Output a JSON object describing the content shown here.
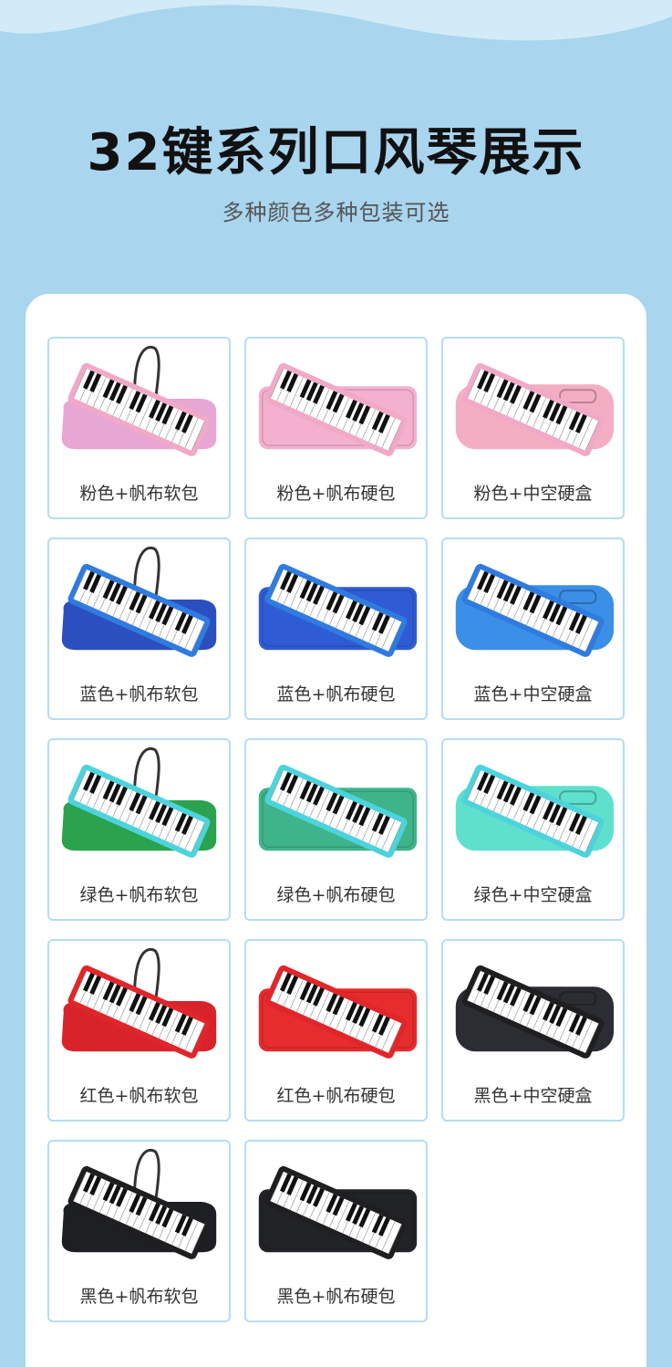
{
  "header": {
    "title": "32键系列口风琴展示",
    "subtitle": "多种颜色多种包装可选"
  },
  "products": [
    {
      "label": "粉色+帆布软包",
      "type": "soft-bag",
      "case_color": "#e7a6d3",
      "board_color": "#f2a9c8"
    },
    {
      "label": "粉色+帆布硬包",
      "type": "hard-bag",
      "case_color": "#f4b1cf",
      "board_color": "#f2a9c8"
    },
    {
      "label": "粉色+中空硬盒",
      "type": "hollow-box",
      "case_color": "#f4aec3",
      "board_color": "#f2a9c8"
    },
    {
      "label": "蓝色+帆布软包",
      "type": "soft-bag",
      "case_color": "#2c4fc0",
      "board_color": "#2f7be0"
    },
    {
      "label": "蓝色+帆布硬包",
      "type": "hard-bag",
      "case_color": "#2f5cd4",
      "board_color": "#2f7be0"
    },
    {
      "label": "蓝色+中空硬盒",
      "type": "hollow-box",
      "case_color": "#3b8fe6",
      "board_color": "#2f7be0"
    },
    {
      "label": "绿色+帆布软包",
      "type": "soft-bag",
      "case_color": "#2aa24e",
      "board_color": "#4cd3dc"
    },
    {
      "label": "绿色+帆布硬包",
      "type": "hard-bag",
      "case_color": "#3fb38a",
      "board_color": "#4cd3dc"
    },
    {
      "label": "绿色+中空硬盒",
      "type": "hollow-box",
      "case_color": "#5fe0cd",
      "board_color": "#4cd3dc"
    },
    {
      "label": "红色+帆布软包",
      "type": "soft-bag",
      "case_color": "#d9232a",
      "board_color": "#e0262b"
    },
    {
      "label": "红色+帆布硬包",
      "type": "hard-bag",
      "case_color": "#e62c2c",
      "board_color": "#e0262b"
    },
    {
      "label": "黑色+中空硬盒",
      "type": "hollow-box",
      "case_color": "#2b2d33",
      "board_color": "#1f1f22"
    },
    {
      "label": "黑色+帆布软包",
      "type": "soft-bag",
      "case_color": "#1e1f22",
      "board_color": "#1f1f22"
    },
    {
      "label": "黑色+帆布硬包",
      "type": "hard-bag",
      "case_color": "#222327",
      "board_color": "#1f1f22"
    }
  ],
  "colors": {
    "background": "#a9d5ef",
    "card_border": "#b5ddf2",
    "wave": "#cfe8f6"
  }
}
